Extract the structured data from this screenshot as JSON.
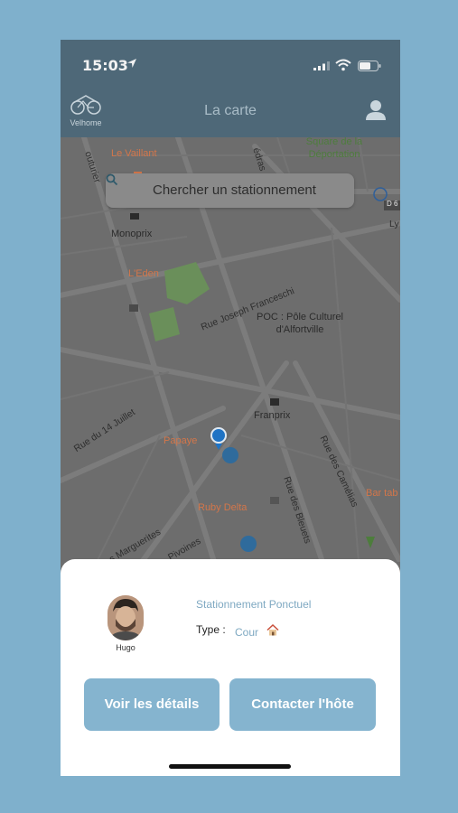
{
  "status": {
    "time": "15:03"
  },
  "navbar": {
    "brand": "Velhome",
    "title": "La carte"
  },
  "search": {
    "placeholder": "Chercher un stationnement"
  },
  "map": {
    "places": {
      "le_vaillant": "Le Vaillant",
      "square": "Square de la Déportation",
      "monoprix": "Monoprix",
      "eden": "L'Eden",
      "poc": "POC : Pôle Culturel d'Alfortville",
      "franprix": "Franprix",
      "papaye": "Papaye",
      "ruby": "Ruby Delta",
      "bar": "Bar tab",
      "road_badge": "D 6"
    },
    "streets": {
      "couturier": "outurier",
      "edras": "édras",
      "franceschi": "Rue Joseph Franceschi",
      "quatorze": "Rue du 14 Juillet",
      "camelias": "Rue des Camélias",
      "bleuets": "Rue des Bleuets",
      "marguerites": "s Marguerites",
      "pivoines": "Pivoines",
      "ly": "Ly"
    }
  },
  "card": {
    "host_name": "Hugo",
    "title": "Stationnement Ponctuel",
    "type_label": "Type :",
    "type_value": "Cour",
    "details_button": "Voir les détails",
    "contact_button": "Contacter l'hôte"
  }
}
